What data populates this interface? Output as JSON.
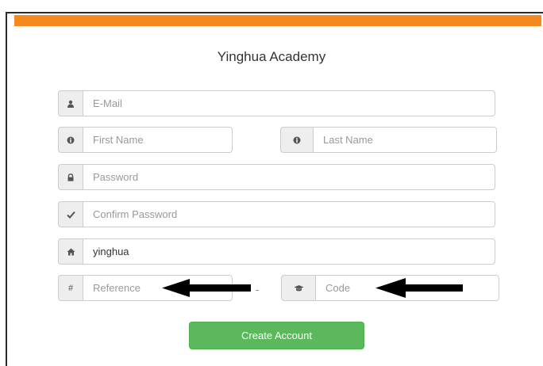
{
  "form": {
    "title": "Yinghua Academy",
    "email_placeholder": "E-Mail",
    "first_name_placeholder": "First Name",
    "last_name_placeholder": "Last Name",
    "password_placeholder": "Password",
    "confirm_password_placeholder": "Confirm Password",
    "school_value": "yinghua",
    "reference_placeholder": "Reference",
    "hash_symbol": "#",
    "separator": "-",
    "code_placeholder": "Code",
    "submit_label": "Create Account"
  },
  "colors": {
    "accent_bar": "#f5891f",
    "submit_button": "#5cb85c"
  },
  "icons": {
    "email": "user-icon",
    "first_name": "info-circle-icon",
    "last_name": "info-circle-icon",
    "password": "lock-icon",
    "confirm_password": "checkmark-icon",
    "school": "home-icon",
    "reference": "hash-icon",
    "code": "graduation-cap-icon"
  },
  "annotations": {
    "arrows": [
      "arrow-pointing-to-reference",
      "arrow-pointing-to-code"
    ]
  }
}
